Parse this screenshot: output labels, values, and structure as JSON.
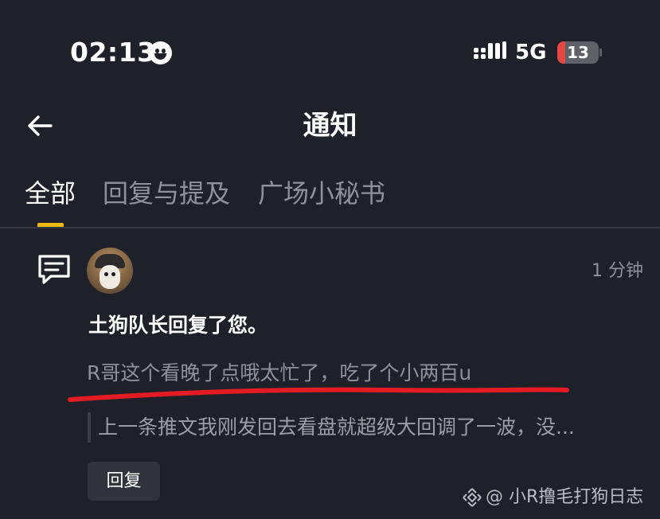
{
  "status_bar": {
    "time": "02:13",
    "network": "5G",
    "battery": {
      "text": "13",
      "fraction": 0.13
    },
    "icons": [
      "smiley-face-icon",
      "signal-bars-icon",
      "battery-icon"
    ]
  },
  "header": {
    "title": "通知",
    "back_icon": "back-arrow-icon"
  },
  "tabs": [
    {
      "label": "全部",
      "active": true
    },
    {
      "label": "回复与提及",
      "active": false
    },
    {
      "label": "广场小秘书",
      "active": false
    }
  ],
  "colors": {
    "background": "#1e2129",
    "accent": "#f0b90b",
    "muted_text": "#8e929c",
    "annotation_red": "#e31b23"
  },
  "notification": {
    "icon": "comment-bubble-icon",
    "time": "1 分钟",
    "headline": "土狗队长回复了您。",
    "reply_text": "R哥这个看晚了点哦太忙了，吃了个小两百u",
    "quoted_text": "上一条推文我刚发回去看盘就超级大回调了一波，没...",
    "reply_button": "回复"
  },
  "watermark": {
    "text": "@ 小R撸毛打狗日志",
    "icon": "binance-logo-icon"
  }
}
